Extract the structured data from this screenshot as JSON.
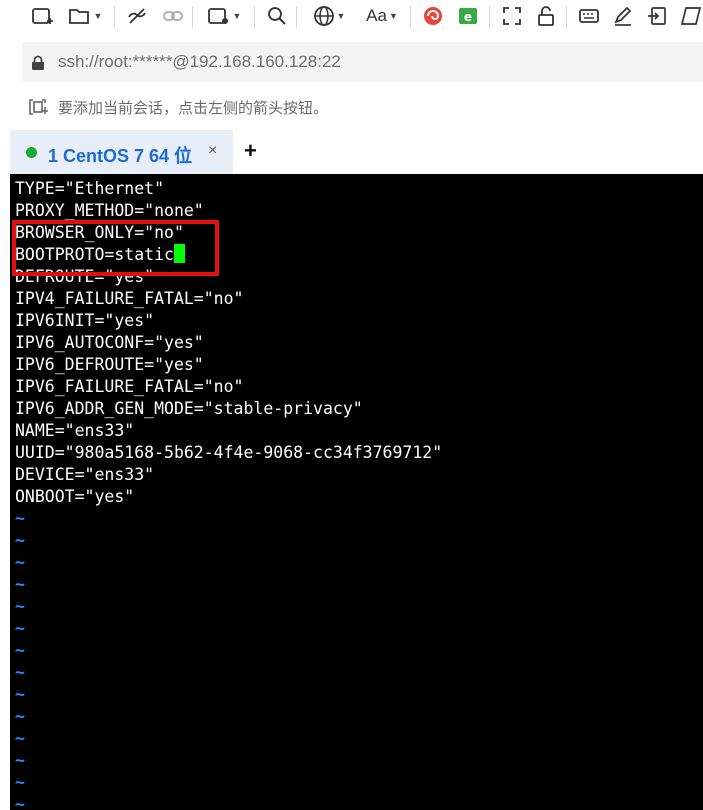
{
  "toolbar": {
    "icons": [
      "new-session-icon",
      "open-folder-icon",
      "disconnect-icon",
      "link-icon",
      "new-window-icon",
      "search-icon",
      "globe-icon",
      "font-icon",
      "app-icon",
      "xftp-icon",
      "fullscreen-icon",
      "lock-icon",
      "keyboard-icon",
      "compose-icon",
      "transfer-icon",
      "script-icon"
    ],
    "font_label": "Aa"
  },
  "address": {
    "text": "ssh://root:******@192.168.160.128:22"
  },
  "hint": {
    "text": "要添加当前会话，点击左侧的箭头按钮。"
  },
  "tab": {
    "label": "1 CentOS 7 64 位",
    "close": "×",
    "status_color": "#1aaa33"
  },
  "newtab": {
    "label": "+"
  },
  "terminal": {
    "lines": [
      "TYPE=\"Ethernet\"",
      "PROXY_METHOD=\"none\"",
      "BROWSER_ONLY=\"no\"",
      "BOOTPROTO=static",
      "DEFROUTE=\"yes\"",
      "IPV4_FAILURE_FATAL=\"no\"",
      "IPV6INIT=\"yes\"",
      "IPV6_AUTOCONF=\"yes\"",
      "IPV6_DEFROUTE=\"yes\"",
      "IPV6_FAILURE_FATAL=\"no\"",
      "IPV6_ADDR_GEN_MODE=\"stable-privacy\"",
      "NAME=\"ens33\"",
      "UUID=\"980a5168-5b62-4f4e-9068-cc34f3769712\"",
      "DEVICE=\"ens33\"",
      "ONBOOT=\"yes\""
    ],
    "tilde": "~",
    "tilde_count": 14
  },
  "colors": {
    "terminal_bg": "#000000",
    "text": "#ffffff",
    "tilde": "#1e90ff",
    "cursor": "#00ff00",
    "highlight": "#e01010",
    "tab_label": "#1b6ad8"
  }
}
